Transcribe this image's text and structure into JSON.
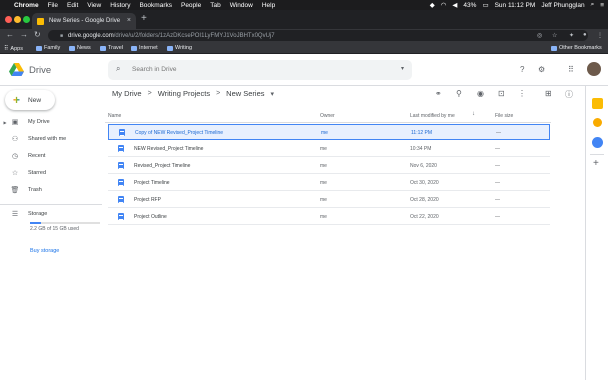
{
  "menubar": {
    "items": [
      "Chrome",
      "File",
      "Edit",
      "View",
      "History",
      "Bookmarks",
      "People",
      "Tab",
      "Window",
      "Help"
    ],
    "battery": "43%",
    "clock": "Sun 11:12 PM",
    "user": "Jeff Phungglan"
  },
  "browser": {
    "tab_title": "New Series - Google Drive",
    "url_host": "drive.google.com",
    "url_path": "/drive/u/2/folders/1zAzDKcsePOI1LyFMYJ1VoJBHTx0QvUj7",
    "bookmarks": [
      "Apps",
      "Family",
      "News",
      "Travel",
      "Internet",
      "Writing"
    ],
    "other_bookmarks": "Other Bookmarks"
  },
  "drive": {
    "brand": "Drive",
    "search_placeholder": "Search in Drive",
    "new_label": "New",
    "nav": [
      "My Drive",
      "Shared with me",
      "Recent",
      "Starred",
      "Trash"
    ],
    "storage_label": "Storage",
    "storage_used": "2.2 GB of 15 GB used",
    "storage_fraction": 0.15,
    "buy_storage": "Buy storage"
  },
  "breadcrumb": {
    "items": [
      "My Drive",
      "Writing Projects",
      "New Series"
    ],
    "sep": ">"
  },
  "columns": {
    "name": "Name",
    "owner": "Owner",
    "modified": "Last modified by me",
    "size": "File size"
  },
  "files": [
    {
      "name": "Copy of NEW Revised_Project Timeline",
      "owner": "me",
      "modified": "11:12 PM",
      "size": "—"
    },
    {
      "name": "NEW Revised_Project Timeline",
      "owner": "me",
      "modified": "10:34 PM",
      "size": "—"
    },
    {
      "name": "Revised_Project Timeline",
      "owner": "me",
      "modified": "Nov 6, 2020",
      "size": "—"
    },
    {
      "name": "Project Timeline",
      "owner": "me",
      "modified": "Oct 30, 2020",
      "size": "—"
    },
    {
      "name": "Project RFP",
      "owner": "me",
      "modified": "Oct 28, 2020",
      "size": "—"
    },
    {
      "name": "Project Outline",
      "owner": "me",
      "modified": "Oct 22, 2020",
      "size": "—"
    }
  ],
  "colors": {
    "accent": "#4285f4",
    "selected_bg": "#e8f0fe",
    "selected_text": "#1967d2"
  }
}
